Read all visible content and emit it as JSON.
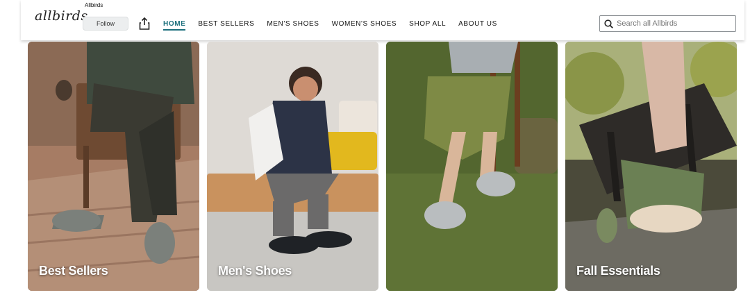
{
  "header": {
    "logo_text": "allbirds",
    "brand_name": "Allbirds",
    "follow_label": "Follow",
    "share_icon": "share-icon"
  },
  "nav": {
    "items": [
      {
        "label": "HOME",
        "active": true
      },
      {
        "label": "BEST SELLERS",
        "active": false
      },
      {
        "label": "MEN'S SHOES",
        "active": false
      },
      {
        "label": "WOMEN'S SHOES",
        "active": false
      },
      {
        "label": "SHOP ALL",
        "active": false
      },
      {
        "label": "ABOUT US",
        "active": false
      }
    ]
  },
  "search": {
    "placeholder": "Search all Allbirds",
    "value": ""
  },
  "tiles": [
    {
      "label": "Best Sellers"
    },
    {
      "label": "Men's Shoes"
    },
    {
      "label": ""
    },
    {
      "label": "Fall Essentials"
    }
  ],
  "colors": {
    "accent": "#1b6f7c"
  }
}
